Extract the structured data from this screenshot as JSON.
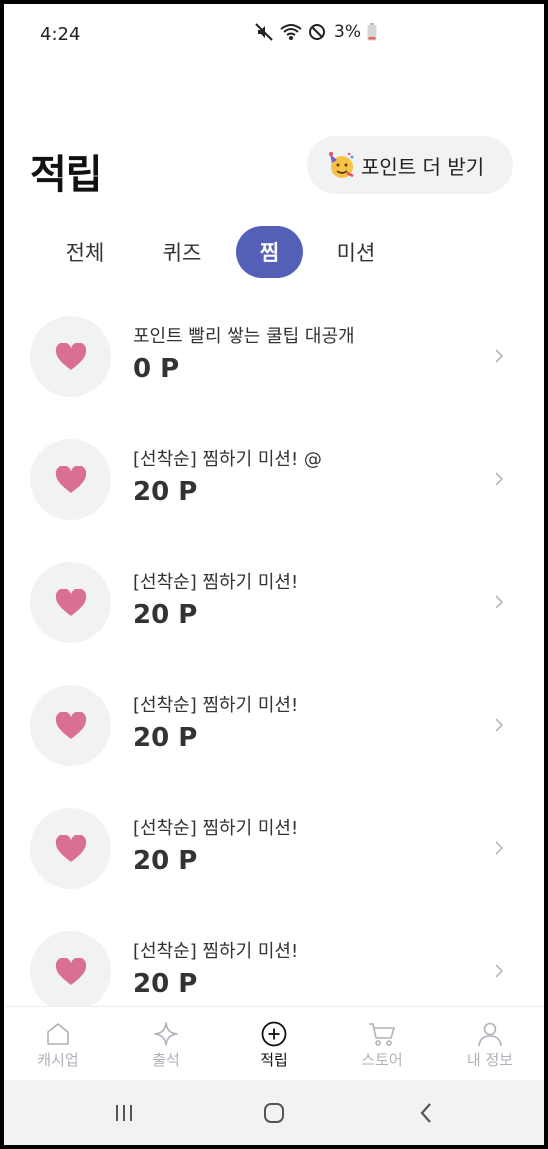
{
  "status_bar": {
    "time": "4:24",
    "battery": "3%",
    "icons": [
      "mute-icon",
      "wifi-icon",
      "do-not-disturb-icon",
      "battery-icon"
    ]
  },
  "header": {
    "title": "적립",
    "more_points_label": "포인트 더 받기",
    "more_points_icon": "party-face-icon"
  },
  "tabs": [
    {
      "label": "전체",
      "active": false
    },
    {
      "label": "퀴즈",
      "active": false
    },
    {
      "label": "찜",
      "active": true
    },
    {
      "label": "미션",
      "active": false
    }
  ],
  "list": [
    {
      "title": "포인트 빨리 쌓는 쿨팁 대공개",
      "points": "0 P",
      "icon": "heart-icon"
    },
    {
      "title": "[선착순] 찜하기 미션! @",
      "points": "20 P",
      "icon": "heart-icon"
    },
    {
      "title": "[선착순] 찜하기 미션!",
      "points": "20 P",
      "icon": "heart-icon"
    },
    {
      "title": "[선착순] 찜하기 미션!",
      "points": "20 P",
      "icon": "heart-icon"
    },
    {
      "title": "[선착순] 찜하기 미션!",
      "points": "20 P",
      "icon": "heart-icon"
    },
    {
      "title": "[선착순] 찜하기 미션!",
      "points": "20 P",
      "icon": "heart-icon"
    }
  ],
  "bottom_nav": [
    {
      "label": "캐시업",
      "icon": "home-icon",
      "active": false
    },
    {
      "label": "출석",
      "icon": "sparkle-icon",
      "active": false
    },
    {
      "label": "적립",
      "icon": "plus-circle-icon",
      "active": true
    },
    {
      "label": "스토어",
      "icon": "cart-icon",
      "active": false
    },
    {
      "label": "내 정보",
      "icon": "person-icon",
      "active": false
    }
  ],
  "colors": {
    "accent": "#5460b8",
    "heart": "#d96f92",
    "icon_bg": "#f1f2f4",
    "inactive_nav": "#aeb2b8"
  }
}
